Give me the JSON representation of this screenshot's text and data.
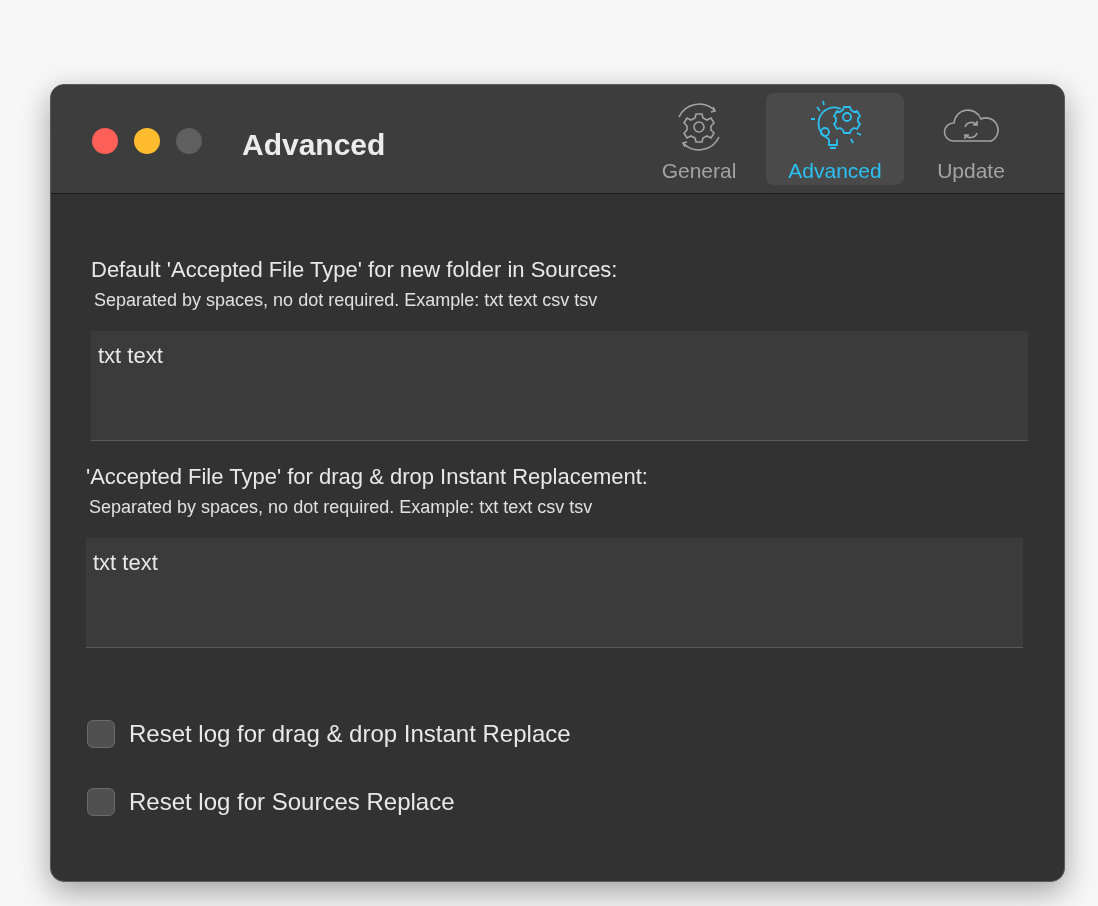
{
  "window": {
    "title": "Advanced"
  },
  "tabs": [
    {
      "label": "General",
      "kind": "gear",
      "selected": false
    },
    {
      "label": "Advanced",
      "kind": "bulb",
      "selected": true
    },
    {
      "label": "Update",
      "kind": "cloud",
      "selected": false
    }
  ],
  "sections": [
    {
      "label": "Default 'Accepted File Type' for new folder in Sources:",
      "hint": "Separated by spaces, no dot required. Example: txt text csv tsv",
      "value": "txt text"
    },
    {
      "label": "'Accepted File Type' for drag & drop Instant Replacement:",
      "hint": "Separated by spaces, no dot required. Example: txt text csv tsv",
      "value": "txt text"
    }
  ],
  "checkboxes": [
    {
      "label": "Reset log for drag & drop Instant Replace",
      "checked": false
    },
    {
      "label": "Reset log for Sources Replace",
      "checked": false
    }
  ]
}
